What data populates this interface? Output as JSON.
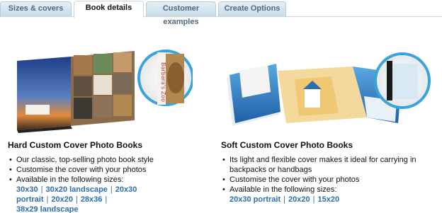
{
  "tabs": [
    {
      "label": "Sizes & covers",
      "active": false
    },
    {
      "label": "Book details",
      "active": true
    },
    {
      "label": "Customer examples",
      "active": false
    },
    {
      "label": "Create Options",
      "active": false
    }
  ],
  "hard": {
    "title": "Hard Custom Cover Photo Books",
    "bullets": [
      "Our classic, top-selling photo book style",
      "Customise the cover with your photos",
      "Available in the following sizes:"
    ],
    "sizes": [
      "30x30",
      "30x20 landscape",
      "20x30 portrait",
      "20x20",
      "28x36",
      "38x29 landscape"
    ],
    "cover_caption": "Barbara's Zoo"
  },
  "soft": {
    "title": "Soft Custom Cover Photo Books",
    "bullets": [
      "Its light and flexible cover makes it ideal for carrying in backpacks or handbags",
      "Customise the cover with your photos",
      "Available in the following sizes:"
    ],
    "sizes": [
      "20x30 portrait",
      "20x20",
      "15x20"
    ]
  },
  "colors": {
    "link": "#2a6fb0",
    "tab_text": "#4b6b82",
    "tab_bg": "#d6e5ef",
    "circle_ring": "#3aa3dc"
  }
}
